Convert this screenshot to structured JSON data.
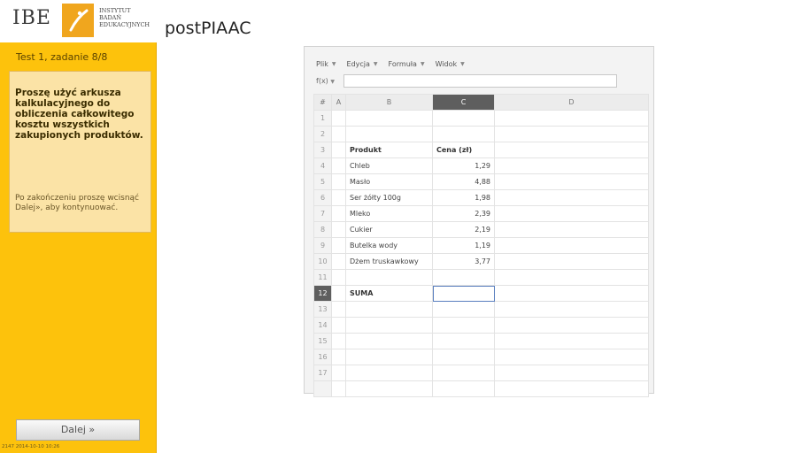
{
  "header": {
    "logo_text": "IBE",
    "institute_lines": [
      "INSTYTUT",
      "BADAŃ",
      "EDUKACYJNYCH"
    ],
    "app_title": "postPIAAC"
  },
  "sidebar": {
    "test_label": "Test 1, zadanie 8/8",
    "task_text": "Proszę użyć arkusza kalkulacyjnego do obliczenia całkowitego kosztu wszystkich zakupionych produktów.",
    "hint_text": "Po zakończeniu proszę wcisnąć Dalej», aby kontynuować.",
    "next_label": "Dalej »",
    "footer_code": "2147 2014-10-10 10:26"
  },
  "spreadsheet": {
    "menu": [
      "Plik",
      "Edycja",
      "Formuła",
      "Widok"
    ],
    "fx_label": "f(x)",
    "columns": [
      "#",
      "A",
      "B",
      "C",
      "D"
    ],
    "active_column": "C",
    "active_row": 12,
    "rows": [
      {
        "n": "1",
        "b": "",
        "c": ""
      },
      {
        "n": "2",
        "b": "",
        "c": ""
      },
      {
        "n": "3",
        "b": "Produkt",
        "c": "Cena (zł)"
      },
      {
        "n": "4",
        "b": "Chleb",
        "c": "1,29"
      },
      {
        "n": "5",
        "b": "Masło",
        "c": "4,88"
      },
      {
        "n": "6",
        "b": "Ser żółty 100g",
        "c": "1,98"
      },
      {
        "n": "7",
        "b": "Mleko",
        "c": "2,39"
      },
      {
        "n": "8",
        "b": "Cukier",
        "c": "2,19"
      },
      {
        "n": "9",
        "b": "Butelka wody",
        "c": "1,19"
      },
      {
        "n": "10",
        "b": "Dżem truskawkowy",
        "c": "3,77"
      },
      {
        "n": "11",
        "b": "",
        "c": ""
      },
      {
        "n": "12",
        "b": "SUMA",
        "c": ""
      },
      {
        "n": "13",
        "b": "",
        "c": ""
      },
      {
        "n": "14",
        "b": "",
        "c": ""
      },
      {
        "n": "15",
        "b": "",
        "c": ""
      },
      {
        "n": "16",
        "b": "",
        "c": ""
      },
      {
        "n": "17",
        "b": "",
        "c": ""
      },
      {
        "n": "",
        "b": "",
        "c": ""
      }
    ]
  },
  "colors": {
    "sidebar_bg": "#fdc20c",
    "task_panel_bg": "#fbe3a6",
    "logo_orange": "#f0a61e",
    "header_dark": "#5e5e5e",
    "selection_blue": "#5a7fbf"
  }
}
